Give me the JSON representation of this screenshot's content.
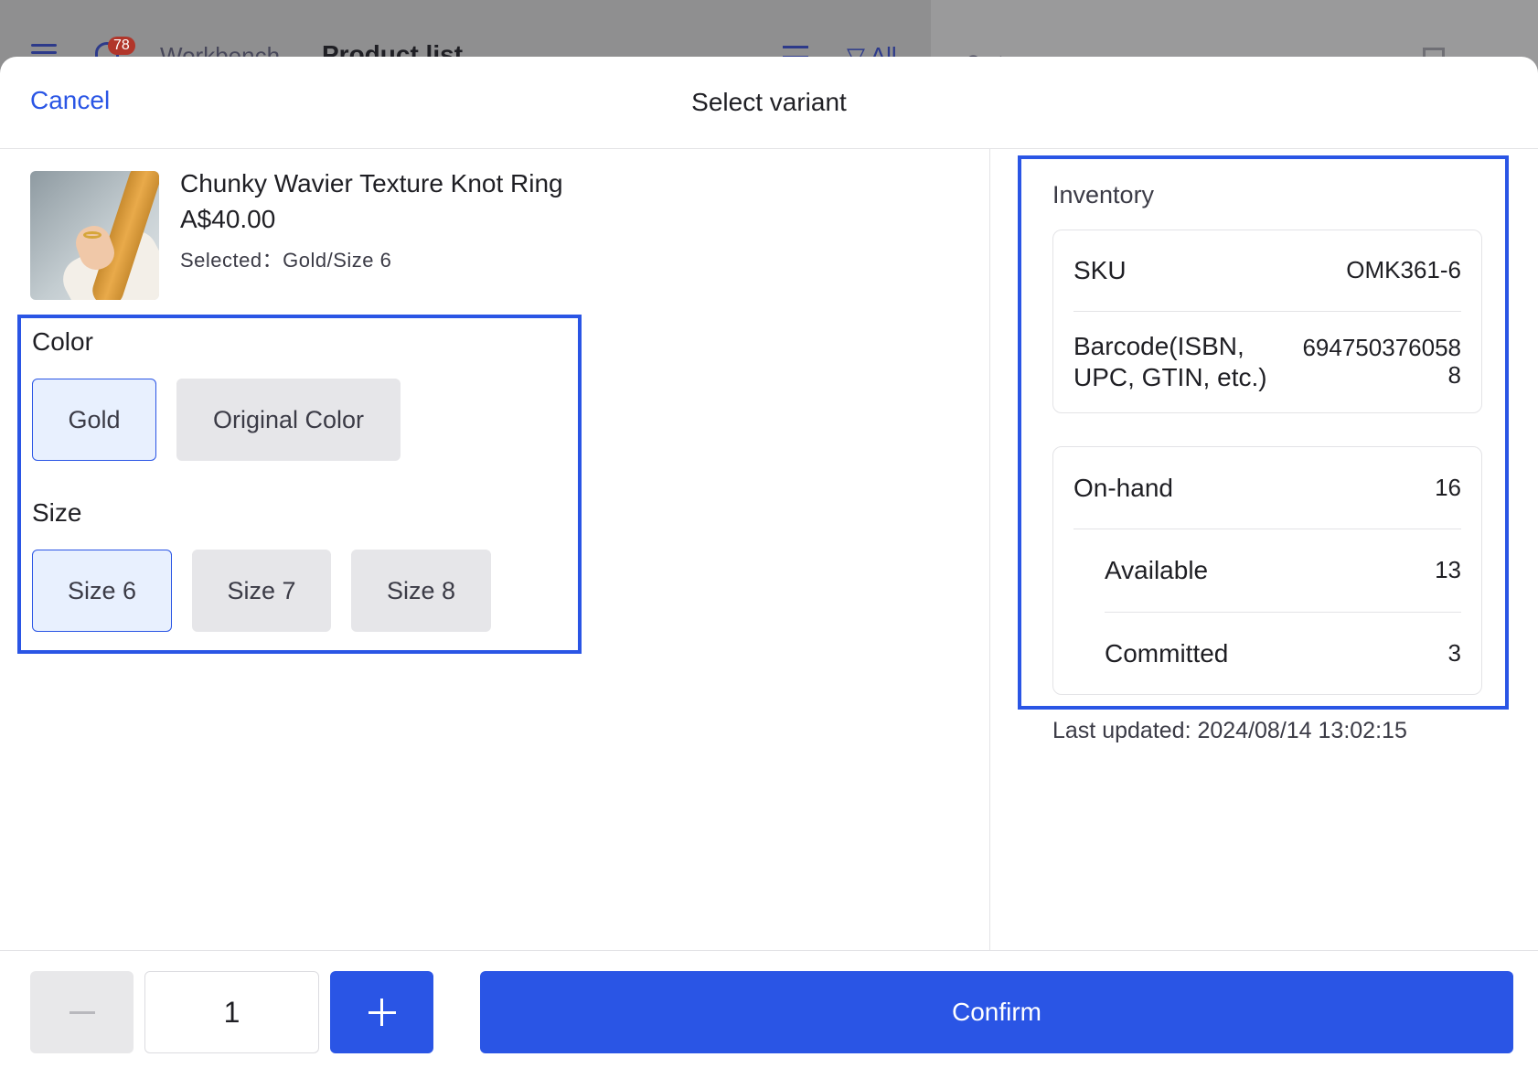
{
  "background": {
    "badge_count": "78",
    "workbench_label": "Workbench",
    "page_title": "Product list",
    "filter_label": "All",
    "right_pane_label": "Cart"
  },
  "modal": {
    "cancel_label": "Cancel",
    "title": "Select variant"
  },
  "product": {
    "name": "Chunky Wavier Texture Knot Ring",
    "price": "A$40.00",
    "selected_text": "Selected：Gold/Size 6"
  },
  "options": {
    "color": {
      "label": "Color",
      "values": [
        "Gold",
        "Original Color"
      ],
      "selected": "Gold"
    },
    "size": {
      "label": "Size",
      "values": [
        "Size 6",
        "Size 7",
        "Size 8"
      ],
      "selected": "Size 6"
    }
  },
  "inventory": {
    "title": "Inventory",
    "sku_label": "SKU",
    "sku_value": "OMK361-6",
    "barcode_label": "Barcode(ISBN, UPC, GTIN, etc.)",
    "barcode_value": "6947503760588",
    "on_hand_label": "On-hand",
    "on_hand_value": "16",
    "available_label": "Available",
    "available_value": "13",
    "committed_label": "Committed",
    "committed_value": "3",
    "last_updated": "Last updated: 2024/08/14 13:02:15"
  },
  "footer": {
    "quantity": "1",
    "confirm_label": "Confirm"
  },
  "colors": {
    "accent": "#2a55e5",
    "selected_bg": "#e8f0fe",
    "option_bg": "#e6e6e9"
  }
}
